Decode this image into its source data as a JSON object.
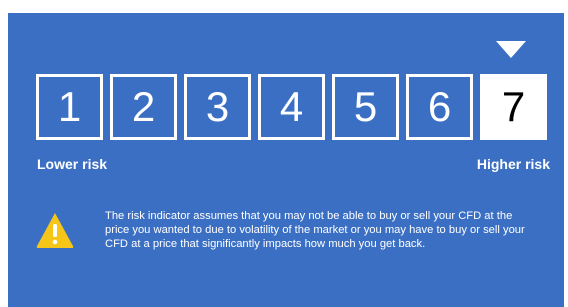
{
  "risk_scale": {
    "levels": [
      "1",
      "2",
      "3",
      "4",
      "5",
      "6",
      "7"
    ],
    "selected_level": 7,
    "lower_label": "Lower risk",
    "higher_label": "Higher risk"
  },
  "warning": {
    "icon": "warning-triangle-icon",
    "text": "The risk indicator assumes that you may not be able to buy or sell your CFD at the price you wanted to  due to volatility of the market or you may have to buy or sell your CFD at a price that significantly impacts how much you get back."
  },
  "colors": {
    "background": "#3a6fc4",
    "text": "#ffffff",
    "selected_box": "#ffffff",
    "selected_text": "#000000",
    "warning_icon": "#f5c518"
  }
}
